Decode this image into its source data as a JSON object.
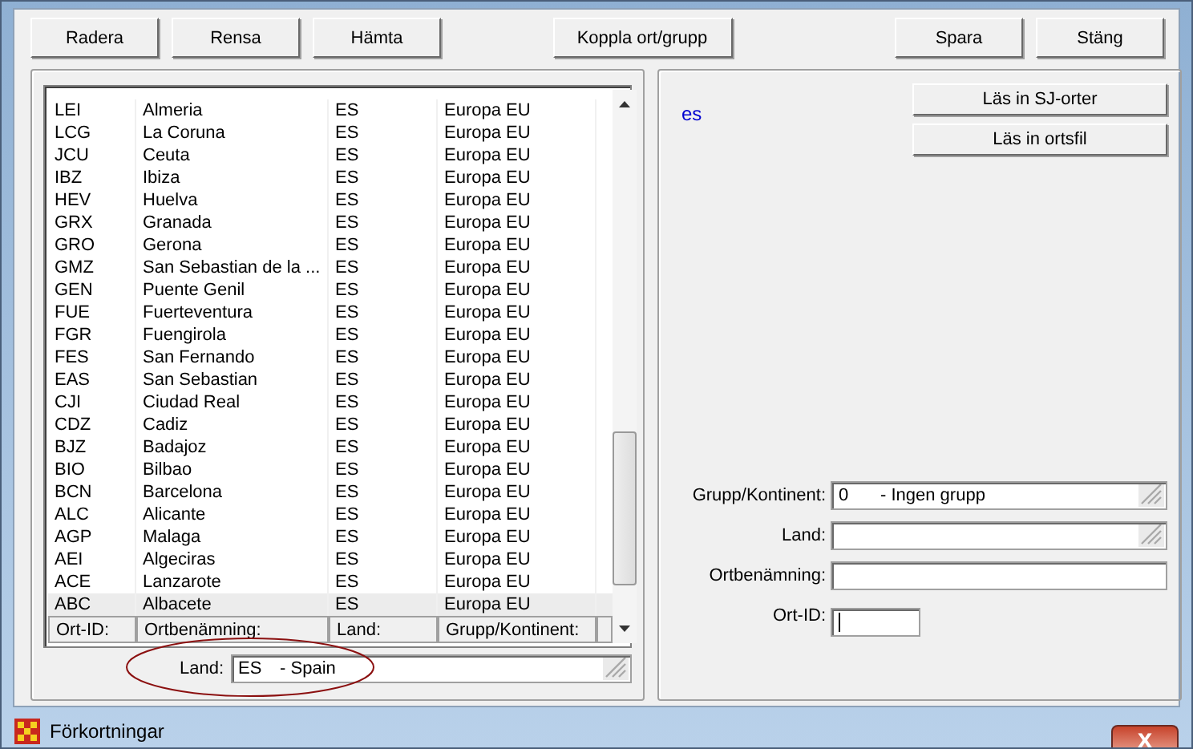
{
  "buttons": [
    [
      "Radera",
      "Rensa",
      "Hämta"
    ],
    [
      "Koppla ort/grupp"
    ],
    [
      "Spara",
      "Stäng"
    ]
  ],
  "left_panel": {
    "table": {
      "rows": [
        {
          "cells": [
            "LEI",
            "Almeria",
            "ES",
            "Europa EU"
          ],
          "selected": false
        },
        {
          "cells": [
            "LCG",
            "La Coruna",
            "ES",
            "Europa EU"
          ],
          "selected": false
        },
        {
          "cells": [
            "JCU",
            "Ceuta",
            "ES",
            "Europa EU"
          ],
          "selected": false
        },
        {
          "cells": [
            "IBZ",
            "Ibiza",
            "ES",
            "Europa EU"
          ],
          "selected": false
        },
        {
          "cells": [
            "HEV",
            "Huelva",
            "ES",
            "Europa EU"
          ],
          "selected": false
        },
        {
          "cells": [
            "GRX",
            "Granada",
            "ES",
            "Europa EU"
          ],
          "selected": false
        },
        {
          "cells": [
            "GRO",
            "Gerona",
            "ES",
            "Europa EU"
          ],
          "selected": false
        },
        {
          "cells": [
            "GMZ",
            "San Sebastian de la ...",
            "ES",
            "Europa EU"
          ],
          "selected": false
        },
        {
          "cells": [
            "GEN",
            "Puente Genil",
            "ES",
            "Europa EU"
          ],
          "selected": false
        },
        {
          "cells": [
            "FUE",
            "Fuerteventura",
            "ES",
            "Europa EU"
          ],
          "selected": false
        },
        {
          "cells": [
            "FGR",
            "Fuengirola",
            "ES",
            "Europa EU"
          ],
          "selected": false
        },
        {
          "cells": [
            "FES",
            "San Fernando",
            "ES",
            "Europa EU"
          ],
          "selected": false
        },
        {
          "cells": [
            "EAS",
            "San Sebastian",
            "ES",
            "Europa EU"
          ],
          "selected": false
        },
        {
          "cells": [
            "CJI",
            "Ciudad Real",
            "ES",
            "Europa EU"
          ],
          "selected": false
        },
        {
          "cells": [
            "CDZ",
            "Cadiz",
            "ES",
            "Europa EU"
          ],
          "selected": false
        },
        {
          "cells": [
            "BJZ",
            "Badajoz",
            "ES",
            "Europa EU"
          ],
          "selected": false
        },
        {
          "cells": [
            "BIO",
            "Bilbao",
            "ES",
            "Europa EU"
          ],
          "selected": false
        },
        {
          "cells": [
            "BCN",
            "Barcelona",
            "ES",
            "Europa EU"
          ],
          "selected": false
        },
        {
          "cells": [
            "ALC",
            "Alicante",
            "ES",
            "Europa EU"
          ],
          "selected": false
        },
        {
          "cells": [
            "AGP",
            "Malaga",
            "ES",
            "Europa EU"
          ],
          "selected": false
        },
        {
          "cells": [
            "AEI",
            "Algeciras",
            "ES",
            "Europa EU"
          ],
          "selected": false
        },
        {
          "cells": [
            "ACE",
            "Lanzarote",
            "ES",
            "Europa EU"
          ],
          "selected": false
        },
        {
          "cells": [
            "ABC",
            "Albacete",
            "ES",
            "Europa EU"
          ],
          "selected": true
        }
      ],
      "footer_labels": [
        "Ort-ID:",
        "Ortbenämning:",
        "Land:",
        "Grupp/Kontinent:"
      ]
    },
    "land_field": {
      "label": "Land:",
      "code": "ES",
      "value": "- Spain",
      "kind": "dropdown"
    }
  },
  "right_panel": {
    "country_code": "es",
    "buttons": [
      "Läs in SJ-orter",
      "Läs in ortsfil"
    ],
    "fields": [
      {
        "label": "Grupp/Kontinent:",
        "kind": "dropdown",
        "code": "0",
        "value": "- Ingen grupp",
        "focused": false
      },
      {
        "label": "Land:",
        "kind": "dropdown",
        "focused": false
      },
      {
        "label": "Ortbenämning:",
        "kind": "text",
        "focused": false
      },
      {
        "label": "Ort-ID:",
        "kind": "short",
        "focused": true
      }
    ]
  },
  "window": {
    "title": "Förkortningar",
    "close": "X"
  }
}
